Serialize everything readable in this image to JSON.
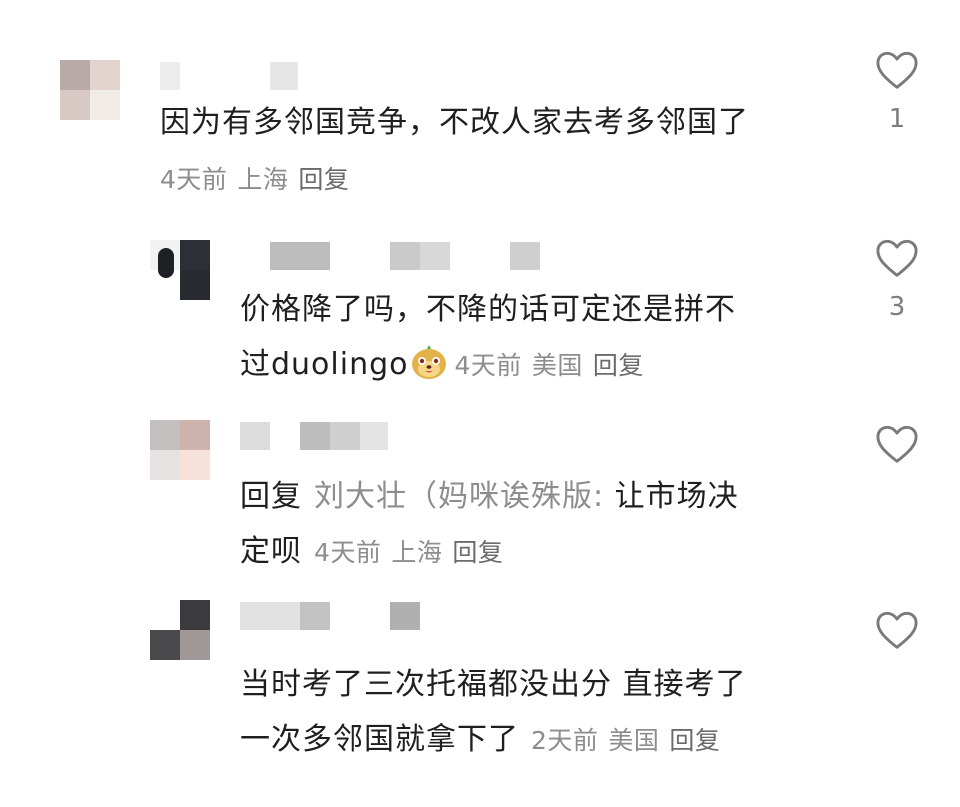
{
  "comments": [
    {
      "text": "因为有多邻国竞争，不改人家去考多邻国了",
      "time": "4天前",
      "location": "上海",
      "reply_label": "回复",
      "likes": "1",
      "like_icon": "heart-outline-icon"
    },
    {
      "text_line1": "价格降了吗，不降的话可定还是拼不",
      "text_line2": "过duolingo",
      "emoji": "dog-face-emoji",
      "time": "4天前",
      "location": "美国",
      "reply_label": "回复",
      "likes": "3",
      "like_icon": "heart-outline-icon"
    },
    {
      "reply_prefix": "回复",
      "reply_to": "刘大壮（妈咪诶殊版:",
      "text_line1_rest": " 让市场决",
      "text_line2": "定呗",
      "time": "4天前",
      "location": "上海",
      "reply_label": "回复",
      "likes": "",
      "like_icon": "heart-outline-icon"
    },
    {
      "text_line1": "当时考了三次托福都没出分 直接考了",
      "text_line2": "一次多邻国就拿下了",
      "time": "2天前",
      "location": "美国",
      "reply_label": "回复",
      "likes": "",
      "like_icon": "heart-outline-icon"
    }
  ],
  "colors": {
    "text": "#1f1f1f",
    "meta": "#8d8d8d",
    "icon": "#7a7a7a"
  }
}
